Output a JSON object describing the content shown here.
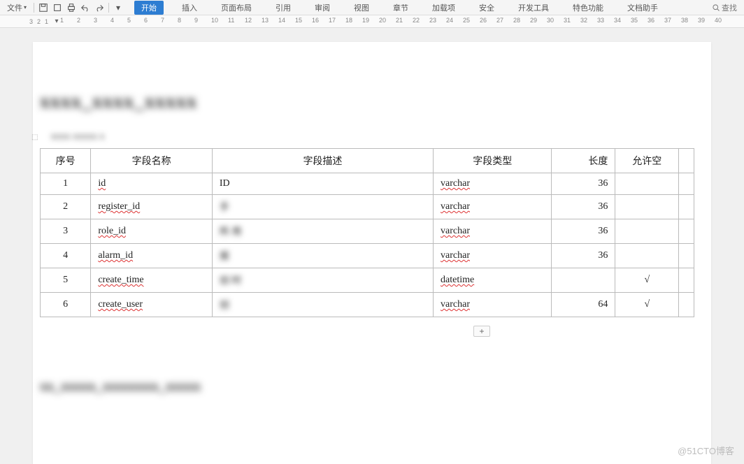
{
  "menu": {
    "file": "文件",
    "tabs": [
      "开始",
      "插入",
      "页面布局",
      "引用",
      "审阅",
      "视图",
      "章节",
      "加载项",
      "安全",
      "开发工具",
      "特色功能",
      "文档助手"
    ],
    "search_label": "查找"
  },
  "ruler": {
    "left_marks": [
      "3",
      "2",
      "1"
    ],
    "ticks": [
      1,
      2,
      3,
      4,
      5,
      6,
      7,
      8,
      9,
      10,
      11,
      12,
      13,
      14,
      15,
      16,
      17,
      18,
      19,
      20,
      21,
      22,
      23,
      24,
      25,
      26,
      27,
      28,
      29,
      30,
      31,
      32,
      33,
      34,
      35,
      36,
      37,
      38,
      39,
      40
    ]
  },
  "doc": {
    "title": "xxxx_xxxx_xxxxx",
    "subtitle": "xxxx  xxxxx x",
    "next_heading": "xx_xxxxx_xxxxxxxx_xxxxx",
    "headers": {
      "seq": "序号",
      "name": "字段名称",
      "desc": "字段描述",
      "type": "字段类型",
      "len": "长度",
      "null": "允许空"
    },
    "rows": [
      {
        "seq": "1",
        "name": "id",
        "desc": "ID",
        "type": "varchar",
        "len": "36",
        "null": ""
      },
      {
        "seq": "2",
        "name": "register_id",
        "desc": "手",
        "type": "varchar",
        "len": "36",
        "null": ""
      },
      {
        "seq": "3",
        "name": "role_id",
        "desc": "所  用",
        "type": "varchar",
        "len": "36",
        "null": ""
      },
      {
        "seq": "4",
        "name": "alarm_id",
        "desc": "报",
        "type": "varchar",
        "len": "36",
        "null": ""
      },
      {
        "seq": "5",
        "name": "create_time",
        "desc": "创  时",
        "type": "datetime",
        "len": "",
        "null": "√"
      },
      {
        "seq": "6",
        "name": "create_user",
        "desc": "创",
        "type": "varchar",
        "len": "64",
        "null": "√"
      }
    ],
    "add_label": "+"
  },
  "watermark": "@51CTO博客"
}
